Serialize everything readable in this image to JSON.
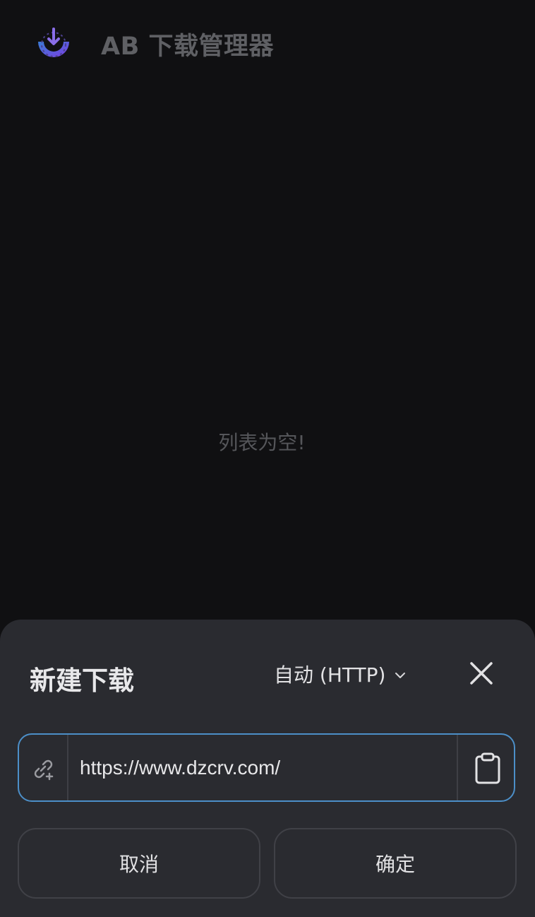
{
  "header": {
    "title": "AB 下载管理器",
    "logo_icon": "download-logo-icon"
  },
  "main": {
    "empty_message": "列表为空!"
  },
  "dialog": {
    "title": "新建下载",
    "mode": {
      "selected": "自动 (HTTP)",
      "icon": "chevron-down-icon"
    },
    "close_icon": "close-icon",
    "url_field": {
      "value": "https://www.dzcrv.com/",
      "leading_icon": "link-add-icon",
      "trailing_icon": "clipboard-icon"
    },
    "buttons": {
      "cancel": "取消",
      "confirm": "确定"
    }
  },
  "colors": {
    "background": "#101012",
    "sheet": "#2a2b30",
    "accent_border": "#4c8fc8",
    "logo_gradient_start": "#7b3fe4",
    "logo_gradient_end": "#3a7bd5"
  }
}
